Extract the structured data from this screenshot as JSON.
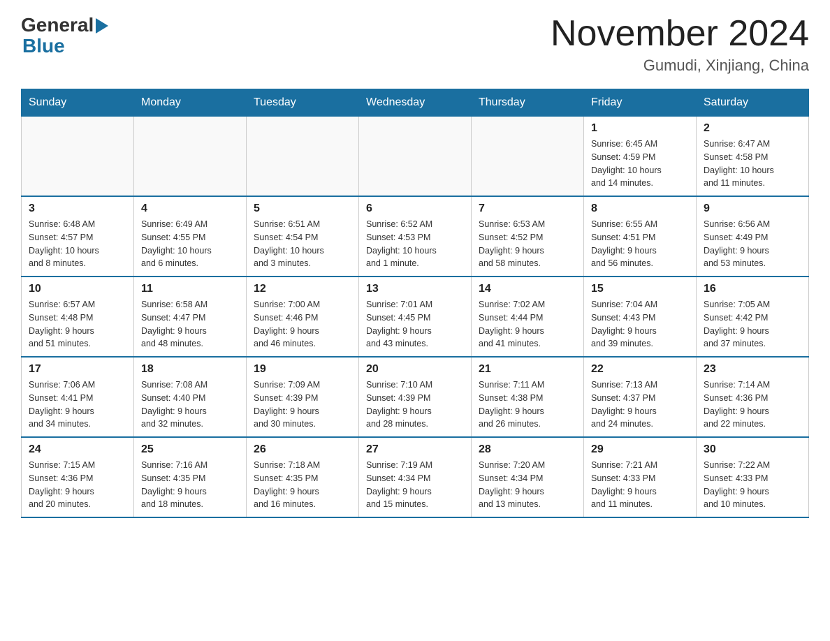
{
  "logo": {
    "text_general": "General",
    "text_blue": "Blue"
  },
  "title": "November 2024",
  "location": "Gumudi, Xinjiang, China",
  "days_of_week": [
    "Sunday",
    "Monday",
    "Tuesday",
    "Wednesday",
    "Thursday",
    "Friday",
    "Saturday"
  ],
  "weeks": [
    [
      {
        "day": "",
        "info": ""
      },
      {
        "day": "",
        "info": ""
      },
      {
        "day": "",
        "info": ""
      },
      {
        "day": "",
        "info": ""
      },
      {
        "day": "",
        "info": ""
      },
      {
        "day": "1",
        "info": "Sunrise: 6:45 AM\nSunset: 4:59 PM\nDaylight: 10 hours\nand 14 minutes."
      },
      {
        "day": "2",
        "info": "Sunrise: 6:47 AM\nSunset: 4:58 PM\nDaylight: 10 hours\nand 11 minutes."
      }
    ],
    [
      {
        "day": "3",
        "info": "Sunrise: 6:48 AM\nSunset: 4:57 PM\nDaylight: 10 hours\nand 8 minutes."
      },
      {
        "day": "4",
        "info": "Sunrise: 6:49 AM\nSunset: 4:55 PM\nDaylight: 10 hours\nand 6 minutes."
      },
      {
        "day": "5",
        "info": "Sunrise: 6:51 AM\nSunset: 4:54 PM\nDaylight: 10 hours\nand 3 minutes."
      },
      {
        "day": "6",
        "info": "Sunrise: 6:52 AM\nSunset: 4:53 PM\nDaylight: 10 hours\nand 1 minute."
      },
      {
        "day": "7",
        "info": "Sunrise: 6:53 AM\nSunset: 4:52 PM\nDaylight: 9 hours\nand 58 minutes."
      },
      {
        "day": "8",
        "info": "Sunrise: 6:55 AM\nSunset: 4:51 PM\nDaylight: 9 hours\nand 56 minutes."
      },
      {
        "day": "9",
        "info": "Sunrise: 6:56 AM\nSunset: 4:49 PM\nDaylight: 9 hours\nand 53 minutes."
      }
    ],
    [
      {
        "day": "10",
        "info": "Sunrise: 6:57 AM\nSunset: 4:48 PM\nDaylight: 9 hours\nand 51 minutes."
      },
      {
        "day": "11",
        "info": "Sunrise: 6:58 AM\nSunset: 4:47 PM\nDaylight: 9 hours\nand 48 minutes."
      },
      {
        "day": "12",
        "info": "Sunrise: 7:00 AM\nSunset: 4:46 PM\nDaylight: 9 hours\nand 46 minutes."
      },
      {
        "day": "13",
        "info": "Sunrise: 7:01 AM\nSunset: 4:45 PM\nDaylight: 9 hours\nand 43 minutes."
      },
      {
        "day": "14",
        "info": "Sunrise: 7:02 AM\nSunset: 4:44 PM\nDaylight: 9 hours\nand 41 minutes."
      },
      {
        "day": "15",
        "info": "Sunrise: 7:04 AM\nSunset: 4:43 PM\nDaylight: 9 hours\nand 39 minutes."
      },
      {
        "day": "16",
        "info": "Sunrise: 7:05 AM\nSunset: 4:42 PM\nDaylight: 9 hours\nand 37 minutes."
      }
    ],
    [
      {
        "day": "17",
        "info": "Sunrise: 7:06 AM\nSunset: 4:41 PM\nDaylight: 9 hours\nand 34 minutes."
      },
      {
        "day": "18",
        "info": "Sunrise: 7:08 AM\nSunset: 4:40 PM\nDaylight: 9 hours\nand 32 minutes."
      },
      {
        "day": "19",
        "info": "Sunrise: 7:09 AM\nSunset: 4:39 PM\nDaylight: 9 hours\nand 30 minutes."
      },
      {
        "day": "20",
        "info": "Sunrise: 7:10 AM\nSunset: 4:39 PM\nDaylight: 9 hours\nand 28 minutes."
      },
      {
        "day": "21",
        "info": "Sunrise: 7:11 AM\nSunset: 4:38 PM\nDaylight: 9 hours\nand 26 minutes."
      },
      {
        "day": "22",
        "info": "Sunrise: 7:13 AM\nSunset: 4:37 PM\nDaylight: 9 hours\nand 24 minutes."
      },
      {
        "day": "23",
        "info": "Sunrise: 7:14 AM\nSunset: 4:36 PM\nDaylight: 9 hours\nand 22 minutes."
      }
    ],
    [
      {
        "day": "24",
        "info": "Sunrise: 7:15 AM\nSunset: 4:36 PM\nDaylight: 9 hours\nand 20 minutes."
      },
      {
        "day": "25",
        "info": "Sunrise: 7:16 AM\nSunset: 4:35 PM\nDaylight: 9 hours\nand 18 minutes."
      },
      {
        "day": "26",
        "info": "Sunrise: 7:18 AM\nSunset: 4:35 PM\nDaylight: 9 hours\nand 16 minutes."
      },
      {
        "day": "27",
        "info": "Sunrise: 7:19 AM\nSunset: 4:34 PM\nDaylight: 9 hours\nand 15 minutes."
      },
      {
        "day": "28",
        "info": "Sunrise: 7:20 AM\nSunset: 4:34 PM\nDaylight: 9 hours\nand 13 minutes."
      },
      {
        "day": "29",
        "info": "Sunrise: 7:21 AM\nSunset: 4:33 PM\nDaylight: 9 hours\nand 11 minutes."
      },
      {
        "day": "30",
        "info": "Sunrise: 7:22 AM\nSunset: 4:33 PM\nDaylight: 9 hours\nand 10 minutes."
      }
    ]
  ]
}
